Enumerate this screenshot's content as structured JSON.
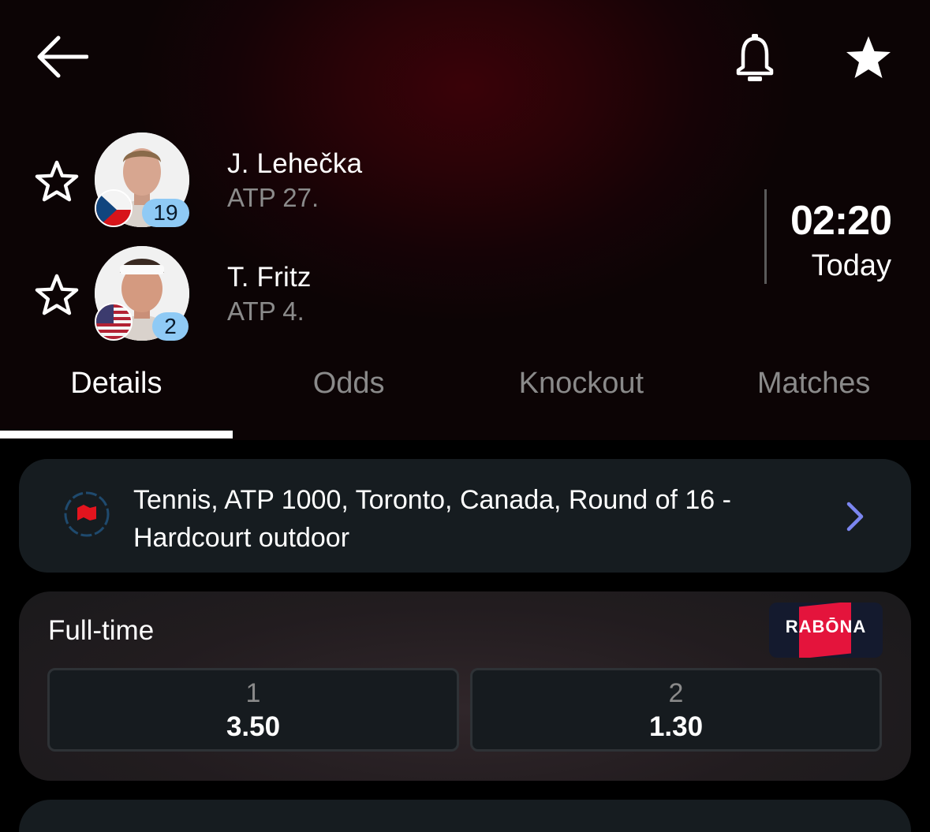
{
  "header": {
    "back_icon": "arrow-left-icon",
    "bell_icon": "bell-icon",
    "favorite_icon": "star-filled-icon"
  },
  "players": [
    {
      "name": "J. Lehečka",
      "rank": "ATP 27.",
      "seed": "19",
      "flag": "czech-flag",
      "favorite_icon": "star-outline-icon"
    },
    {
      "name": "T. Fritz",
      "rank": "ATP 4.",
      "seed": "2",
      "flag": "usa-flag",
      "favorite_icon": "star-outline-icon"
    }
  ],
  "match": {
    "time": "02:20",
    "day": "Today"
  },
  "tabs": [
    {
      "label": "Details",
      "active": true
    },
    {
      "label": "Odds",
      "active": false
    },
    {
      "label": "Knockout",
      "active": false
    },
    {
      "label": "Matches",
      "active": false
    }
  ],
  "tournament": {
    "text": "Tennis, ATP 1000, Toronto, Canada, Round of 16 - Hardcourt outdoor",
    "logo_icon": "canada-flag-icon",
    "chevron_icon": "chevron-right-icon"
  },
  "odds": {
    "title": "Full-time",
    "bookmaker": "RABŌNA",
    "options": [
      {
        "label": "1",
        "value": "3.50"
      },
      {
        "label": "2",
        "value": "1.30"
      }
    ]
  },
  "colors": {
    "header_bg": "#2a0307",
    "seed_badge": "#8fcaf5",
    "chevron": "#7b86f0",
    "bookmaker_red": "#e4143c"
  }
}
